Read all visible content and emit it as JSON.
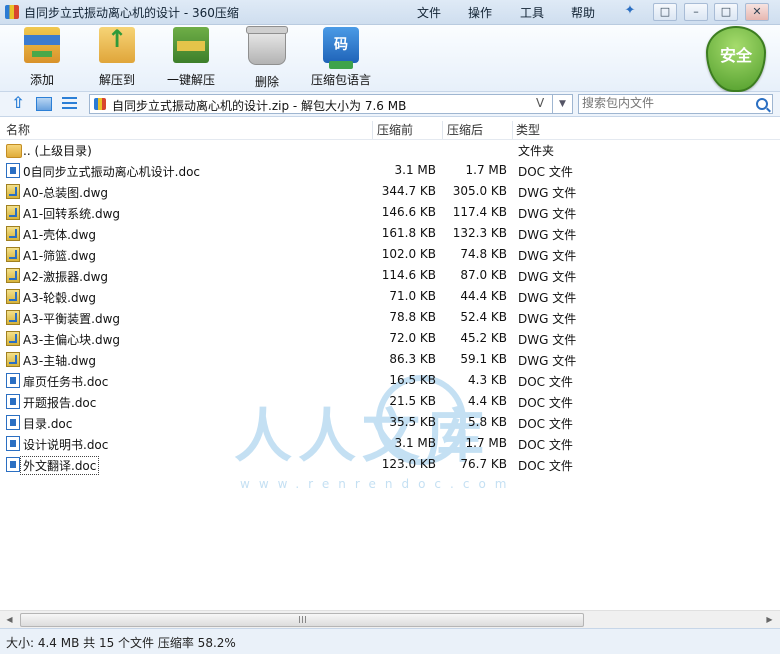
{
  "window": {
    "title": "自同步立式振动离心机的设计 - 360压缩",
    "menus": [
      "文件",
      "操作",
      "工具",
      "帮助"
    ]
  },
  "toolbar": {
    "buttons": [
      {
        "label": "添加",
        "icon": "add-archive-icon"
      },
      {
        "label": "解压到",
        "icon": "extract-to-icon"
      },
      {
        "label": "一键解压",
        "icon": "one-click-extract-icon"
      },
      {
        "label": "删除",
        "icon": "trash-icon"
      },
      {
        "label": "压缩包语言",
        "icon": "archive-language-icon",
        "icon_text": "码"
      }
    ],
    "security_badge": "安全"
  },
  "address": {
    "path": "自同步立式振动离心机的设计.zip - 解包大小为 7.6 MB",
    "verified_mark": "V",
    "search_placeholder": "搜索包内文件"
  },
  "columns": {
    "name": "名称",
    "size": "压缩前",
    "packed": "压缩后",
    "type": "类型"
  },
  "files": [
    {
      "name": ".. (上级目录)",
      "size": "",
      "packed": "",
      "type": "文件夹",
      "icon": "folder-icon"
    },
    {
      "name": "0自同步立式振动离心机设计.doc",
      "size": "3.1 MB",
      "packed": "1.7 MB",
      "type": "DOC 文件",
      "icon": "doc-file-icon"
    },
    {
      "name": "A0-总装图.dwg",
      "size": "344.7 KB",
      "packed": "305.0 KB",
      "type": "DWG 文件",
      "icon": "dwg-file-icon"
    },
    {
      "name": "A1-回转系统.dwg",
      "size": "146.6 KB",
      "packed": "117.4 KB",
      "type": "DWG 文件",
      "icon": "dwg-file-icon"
    },
    {
      "name": "A1-壳体.dwg",
      "size": "161.8 KB",
      "packed": "132.3 KB",
      "type": "DWG 文件",
      "icon": "dwg-file-icon"
    },
    {
      "name": "A1-筛篮.dwg",
      "size": "102.0 KB",
      "packed": "74.8 KB",
      "type": "DWG 文件",
      "icon": "dwg-file-icon"
    },
    {
      "name": "A2-激振器.dwg",
      "size": "114.6 KB",
      "packed": "87.0 KB",
      "type": "DWG 文件",
      "icon": "dwg-file-icon"
    },
    {
      "name": "A3-轮毂.dwg",
      "size": "71.0 KB",
      "packed": "44.4 KB",
      "type": "DWG 文件",
      "icon": "dwg-file-icon"
    },
    {
      "name": "A3-平衡装置.dwg",
      "size": "78.8 KB",
      "packed": "52.4 KB",
      "type": "DWG 文件",
      "icon": "dwg-file-icon"
    },
    {
      "name": "A3-主偏心块.dwg",
      "size": "72.0 KB",
      "packed": "45.2 KB",
      "type": "DWG 文件",
      "icon": "dwg-file-icon"
    },
    {
      "name": "A3-主轴.dwg",
      "size": "86.3 KB",
      "packed": "59.1 KB",
      "type": "DWG 文件",
      "icon": "dwg-file-icon"
    },
    {
      "name": "扉页任务书.doc",
      "size": "16.5 KB",
      "packed": "4.3 KB",
      "type": "DOC 文件",
      "icon": "doc-file-icon"
    },
    {
      "name": "开题报告.doc",
      "size": "21.5 KB",
      "packed": "4.4 KB",
      "type": "DOC 文件",
      "icon": "doc-file-icon"
    },
    {
      "name": "目录.doc",
      "size": "35.5 KB",
      "packed": "5.8 KB",
      "type": "DOC 文件",
      "icon": "doc-file-icon"
    },
    {
      "name": "设计说明书.doc",
      "size": "3.1 MB",
      "packed": "1.7 MB",
      "type": "DOC 文件",
      "icon": "doc-file-icon"
    },
    {
      "name": "外文翻译.doc",
      "size": "123.0 KB",
      "packed": "76.7 KB",
      "type": "DOC 文件",
      "icon": "doc-file-icon",
      "selected": true
    }
  ],
  "watermark": {
    "text": "人人文库",
    "url": "www.renrendoc.com"
  },
  "status": {
    "text": "大小: 4.4 MB 共 15 个文件 压缩率 58.2%"
  }
}
